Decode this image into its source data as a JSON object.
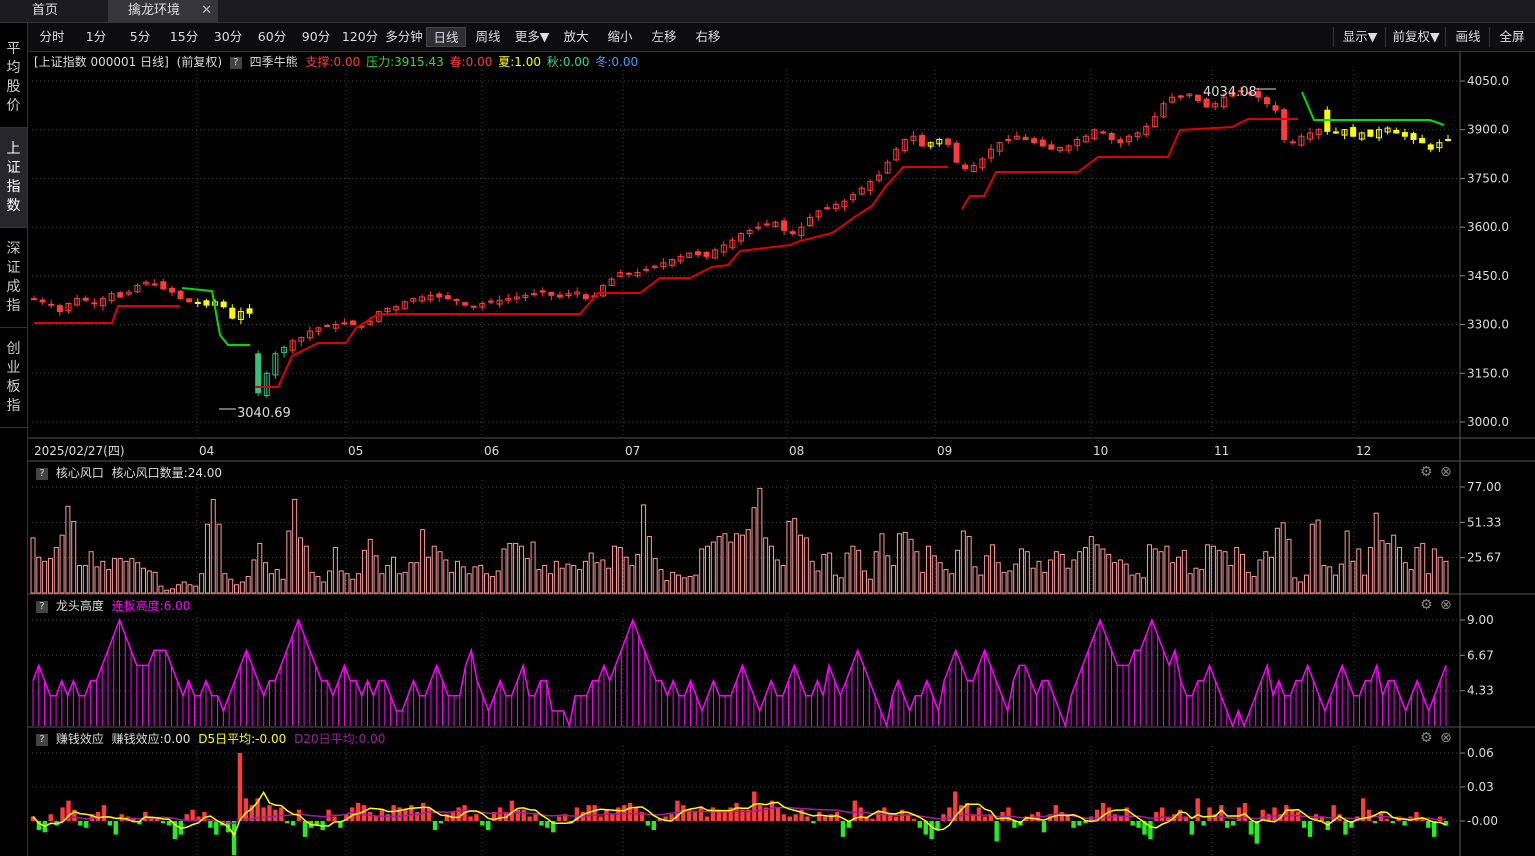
{
  "tabs": {
    "home": "首页",
    "active": "擒龙环境",
    "close": "✕"
  },
  "sidebar": [
    {
      "label": "平均股价",
      "active": false
    },
    {
      "label": "上证指数",
      "active": true
    },
    {
      "label": "深证成指",
      "active": false
    },
    {
      "label": "创业板指",
      "active": false
    }
  ],
  "toolbar": {
    "periods": [
      "分时",
      "1分",
      "5分",
      "15分",
      "30分",
      "60分",
      "90分",
      "120分",
      "多分钟",
      "日线",
      "周线",
      "更多▼",
      "放大",
      "缩小",
      "左移",
      "右移"
    ],
    "selected": "日线",
    "right": [
      "显示▼",
      "前复权▼",
      "画线",
      "全屏"
    ]
  },
  "main_info": {
    "name": "[上证指数 000001 日线]",
    "adj": "(前复权)",
    "q": "?",
    "indicator": "四季牛熊",
    "support": "支撑:0.00",
    "pressure": "压力:3915.43",
    "spring": "春:0.00",
    "summer": "夏:1.00",
    "autumn": "秋:0.00",
    "winter": "冬:0.00"
  },
  "colors": {
    "up": "#ff3b3b",
    "down": "#34c27a",
    "yellow": "#ffff00",
    "support_line": "#e00000",
    "pressure_line": "#00dd00",
    "magenta": "#ff00ff",
    "bar_pink": "#ff9a9a"
  },
  "chart_data": [
    {
      "type": "candlestick",
      "title": "[上证指数 000001 日线]",
      "ylim": [
        3000,
        4050
      ],
      "y_ticks": [
        "4050.0",
        "3900.0",
        "3750.0",
        "3600.0",
        "3450.0",
        "3300.0",
        "3150.0",
        "3000.0"
      ],
      "x_ticks": [
        "2025/02/27(四)",
        "04",
        "05",
        "06",
        "07",
        "08",
        "09",
        "10",
        "11",
        "12"
      ],
      "annotations": {
        "high": "4034.08",
        "low": "3040.69"
      },
      "approx_close_series": [
        3380,
        3370,
        3360,
        3340,
        3365,
        3380,
        3375,
        3365,
        3380,
        3395,
        3385,
        3400,
        3420,
        3430,
        3425,
        3410,
        3400,
        3380,
        3370,
        3365,
        3360,
        3370,
        3355,
        3320,
        3340,
        3335,
        3090,
        3150,
        3210,
        3230,
        3250,
        3260,
        3280,
        3290,
        3295,
        3300,
        3305,
        3300,
        3295,
        3310,
        3340,
        3350,
        3355,
        3370,
        3380,
        3385,
        3390,
        3385,
        3380,
        3375,
        3360,
        3355,
        3365,
        3370,
        3375,
        3380,
        3385,
        3390,
        3395,
        3400,
        3390,
        3385,
        3395,
        3400,
        3380,
        3385,
        3420,
        3440,
        3460,
        3455,
        3460,
        3470,
        3480,
        3490,
        3500,
        3510,
        3520,
        3515,
        3510,
        3530,
        3545,
        3560,
        3580,
        3590,
        3600,
        3610,
        3615,
        3590,
        3580,
        3600,
        3630,
        3650,
        3660,
        3670,
        3680,
        3700,
        3720,
        3740,
        3760,
        3800,
        3840,
        3870,
        3880,
        3850,
        3860,
        3870,
        3855,
        3800,
        3780,
        3790,
        3810,
        3840,
        3860,
        3870,
        3880,
        3870,
        3860,
        3850,
        3840,
        3845,
        3850,
        3870,
        3880,
        3900,
        3890,
        3870,
        3860,
        3880,
        3890,
        3910,
        3940,
        3980,
        4000,
        4000,
        4010,
        3990,
        3970,
        3980,
        4000,
        4010,
        4020,
        4010,
        4000,
        3980,
        3960,
        3870,
        3860,
        3880,
        3890,
        3900,
        3895,
        3890,
        3900,
        3880,
        3890,
        3880,
        3900,
        3905,
        3890,
        3880,
        3870,
        3860,
        3840,
        3860,
        3870
      ],
      "series": [
        {
          "name": "支撑",
          "color": "#e00000"
        },
        {
          "name": "压力",
          "color": "#00dd00"
        }
      ]
    },
    {
      "type": "bar",
      "title": "核心风口",
      "label": "核心风口数量:24.00",
      "ylim": [
        0,
        80
      ],
      "y_ticks": [
        "77.00",
        "51.33",
        "25.67"
      ],
      "values": [
        40,
        26,
        23,
        25,
        33,
        42,
        63,
        52,
        20,
        20,
        30,
        19,
        23,
        17,
        25,
        25,
        23,
        25,
        22,
        18,
        16,
        15,
        5,
        2,
        3,
        6,
        8,
        6,
        5,
        14,
        50,
        68,
        50,
        14,
        10,
        6,
        8,
        12,
        24,
        36,
        22,
        14,
        17,
        10,
        45,
        68,
        40,
        34,
        15,
        12,
        8,
        16,
        33,
        16,
        14,
        10,
        14,
        31,
        39,
        27,
        14,
        20,
        26,
        14,
        15,
        22,
        22,
        46,
        26,
        34,
        30,
        24,
        15,
        23,
        19,
        14,
        19,
        20,
        14,
        12,
        16,
        32,
        36,
        36,
        34,
        25,
        37,
        17,
        20,
        14,
        23,
        18,
        21,
        20,
        17,
        23,
        29,
        22,
        24,
        18,
        34,
        33,
        26,
        20,
        28,
        64,
        41,
        25,
        17,
        9,
        15,
        13,
        11,
        12,
        13,
        32,
        34,
        37,
        41,
        43,
        37,
        43,
        42,
        46,
        62,
        76,
        40,
        34,
        24,
        20,
        52,
        54,
        42,
        40,
        23,
        16,
        28,
        29,
        13,
        11,
        29,
        34,
        31,
        16,
        10,
        30,
        43,
        27,
        20,
        43,
        44,
        39,
        30,
        15,
        34,
        27,
        22,
        17,
        14,
        31,
        45,
        41,
        19,
        13,
        27,
        35,
        22,
        15,
        16,
        21,
        32,
        30,
        18,
        23,
        15,
        24,
        30,
        28,
        18,
        24,
        30,
        33,
        41,
        35,
        32,
        28,
        22,
        24,
        21,
        13,
        14,
        11,
        35,
        32,
        30,
        34,
        22,
        26,
        31,
        14,
        18,
        17,
        35,
        34,
        31,
        30,
        20,
        33,
        28,
        15,
        12,
        24,
        30,
        26,
        47,
        51,
        39,
        11,
        8,
        13,
        50,
        53,
        20,
        19,
        13,
        21,
        45,
        23,
        32,
        13,
        33,
        58,
        38,
        36,
        42,
        33,
        22,
        17,
        33,
        36,
        14,
        32,
        26,
        23
      ]
    },
    {
      "type": "area",
      "title": "龙头高度",
      "label": "连板高度:6.00",
      "ylim": [
        2,
        9.5
      ],
      "y_ticks": [
        "9.00",
        "6.67",
        "4.33"
      ],
      "values": [
        5,
        6,
        5,
        4,
        4,
        5,
        4,
        5,
        4,
        4,
        5,
        5,
        6,
        7,
        8,
        9,
        8,
        7,
        6,
        6,
        6,
        7,
        7,
        7,
        6,
        5,
        4,
        5,
        4,
        4,
        5,
        4,
        4,
        3,
        4,
        5,
        6,
        7,
        6,
        5,
        4,
        5,
        5,
        6,
        7,
        8,
        9,
        8,
        7,
        6,
        5,
        5,
        4,
        5,
        6,
        5,
        5,
        4,
        5,
        4,
        5,
        5,
        4,
        3,
        3,
        4,
        5,
        4,
        4,
        5,
        6,
        5,
        4,
        4,
        4,
        6,
        7,
        5,
        4,
        3,
        4,
        5,
        4,
        4,
        5,
        6,
        4,
        4,
        5,
        5,
        3,
        3,
        3,
        2,
        4,
        4,
        4,
        5,
        5,
        6,
        5,
        6,
        7,
        8,
        9,
        8,
        7,
        6,
        5,
        5,
        4,
        5,
        4,
        4,
        5,
        4,
        3,
        4,
        5,
        4,
        4,
        4,
        5,
        6,
        5,
        4,
        3,
        4,
        5,
        4,
        4,
        5,
        6,
        5,
        4,
        4,
        5,
        4,
        6,
        5,
        4,
        5,
        6,
        7,
        6,
        5,
        4,
        3,
        2,
        4,
        5,
        4,
        3,
        4,
        4,
        5,
        4,
        3,
        5,
        6,
        7,
        6,
        5,
        5,
        6,
        7,
        6,
        5,
        4,
        3,
        5,
        6,
        6,
        5,
        4,
        5,
        5,
        4,
        3,
        2,
        4,
        5,
        6,
        7,
        8,
        9,
        8,
        7,
        6,
        6,
        6,
        7,
        7,
        8,
        9,
        8,
        7,
        6,
        7,
        5,
        4,
        4,
        5,
        5,
        6,
        5,
        4,
        3,
        2,
        3,
        2,
        3,
        4,
        5,
        6,
        4,
        5,
        4,
        4,
        5,
        5,
        6,
        5,
        4,
        3,
        4,
        5,
        6,
        5,
        4,
        4,
        5,
        5,
        6,
        4,
        5,
        5,
        4,
        3,
        4,
        5,
        4,
        3,
        4,
        5,
        6
      ]
    },
    {
      "type": "bar",
      "title": "赚钱效应",
      "label": "赚钱效应:0.00",
      "d5": "D5日平均:-0.00",
      "d20": "D20日平均:0.00",
      "ylim": [
        -0.03,
        0.07
      ],
      "y_ticks": [
        "0.06",
        "0.03",
        "-0.00"
      ],
      "values": [
        0.004,
        -0.008,
        -0.01,
        0.006,
        -0.004,
        0.012,
        0.018,
        0.01,
        -0.004,
        -0.006,
        0.006,
        0.008,
        0.014,
        -0.004,
        -0.012,
        0.006,
        0.004,
        0.003,
        -0.003,
        0.008,
        0.004,
        0.002,
        -0.002,
        -0.004,
        -0.016,
        -0.012,
        0.006,
        0.01,
        0.004,
        0.008,
        -0.006,
        -0.012,
        -0.004,
        -0.01,
        -0.03,
        0.06,
        0.02,
        0.014,
        0.02,
        0.012,
        0.014,
        0.01,
        0.012,
        -0.002,
        -0.004,
        0.01,
        -0.014,
        -0.006,
        -0.004,
        -0.008,
        0.01,
        0.004,
        -0.006,
        0.006,
        0.012,
        0.016,
        0.014,
        0.008,
        0.004,
        0.01,
        0.006,
        0.014,
        0.012,
        0.01,
        0.014,
        0.008,
        0.016,
        0.012,
        -0.008,
        -0.002,
        0.006,
        0.008,
        0.012,
        0.014,
        0.004,
        0.006,
        -0.004,
        -0.008,
        0.008,
        0.012,
        0.008,
        0.018,
        0.01,
        0.01,
        0.004,
        0.006,
        -0.004,
        -0.006,
        -0.01,
        0.004,
        0.006,
        -0.002,
        0.012,
        0.008,
        0.014,
        0.014,
        0.004,
        0.01,
        0.006,
        0.012,
        0.014,
        0.016,
        0.012,
        0.008,
        -0.004,
        -0.008,
        0.002,
        0.004,
        0.006,
        0.018,
        0.014,
        0.01,
        0.008,
        0.012,
        0.004,
        0.012,
        0.01,
        0.008,
        0.012,
        0.016,
        0.01,
        0.01,
        0.026,
        0.014,
        0.012,
        0.018,
        0.012,
        0.006,
        0.004,
        0.006,
        0.01,
        0.004,
        -0.002,
        0.008,
        0.004,
        0.006,
        0.008,
        -0.014,
        -0.006,
        0.018,
        0.012,
        0.004,
        0.002,
        0.008,
        0.012,
        0.006,
        0.004,
        0.01,
        0.006,
        0.002,
        -0.006,
        -0.012,
        -0.016,
        -0.008,
        0.006,
        0.012,
        0.026,
        0.014,
        0.016,
        0.006,
        0.012,
        0.004,
        0.006,
        -0.018,
        0.008,
        0.012,
        -0.006,
        -0.004,
        0.004,
        0.006,
        0.008,
        -0.01,
        0.006,
        0.014,
        0.008,
        0.006,
        -0.006,
        -0.004,
        -0.002,
        0.004,
        0.01,
        0.016,
        0.012,
        0.006,
        0.004,
        0.012,
        -0.004,
        -0.006,
        -0.012,
        -0.016,
        0.008,
        0.012,
        0.004,
        0.006,
        0.01,
        0.004,
        -0.012,
        0.02,
        -0.004,
        0.012,
        0.006,
        0.014,
        -0.006,
        -0.004,
        0.012,
        0.016,
        -0.012,
        -0.02,
        0.01,
        0.006,
        0.012,
        0.006,
        0.014,
        0.01,
        0.008,
        -0.006,
        -0.014,
        0.006,
        0.004,
        -0.008,
        0.014,
        0.006,
        -0.012,
        -0.006,
        0.004,
        0.02,
        0.01,
        -0.002,
        0.008,
        0.002,
        -0.002,
        0.004,
        -0.004,
        0.004,
        0.008,
        0.002,
        -0.006,
        -0.014,
        0.004,
        -0.004
      ]
    }
  ]
}
